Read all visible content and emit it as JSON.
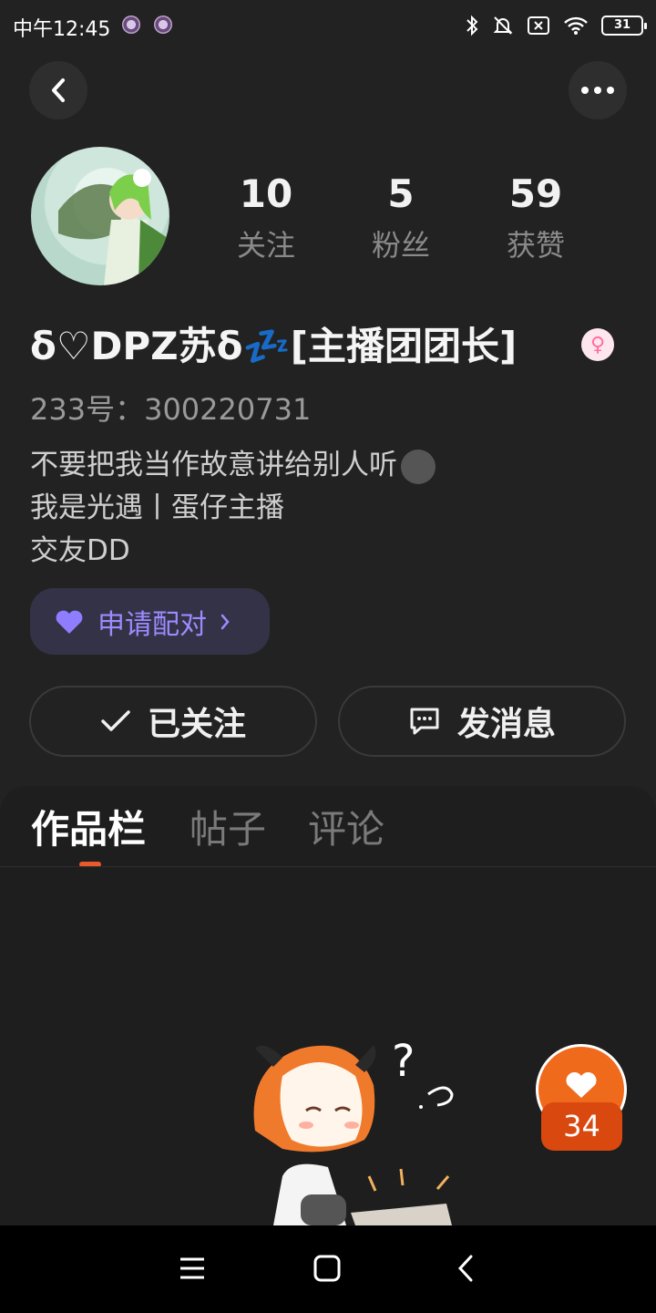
{
  "status_bar": {
    "time": "中午12:45",
    "battery": "31"
  },
  "profile": {
    "stats": [
      {
        "value": "10",
        "label": "关注"
      },
      {
        "value": "5",
        "label": "粉丝"
      },
      {
        "value": "59",
        "label": "获赞"
      }
    ],
    "nickname": "δ♡DPZ苏δ💤[主播团团长]",
    "gender_symbol": "♀",
    "uid": "233号：300220731",
    "bio_lines": [
      "不要把我当作故意讲给别人听",
      "我是光遇丨蛋仔主播",
      "交友DD"
    ],
    "pair_button": "申请配对",
    "follow_button": "已关注",
    "message_button": "发消息"
  },
  "tabs": [
    {
      "label": "作品栏",
      "active": true
    },
    {
      "label": "帖子",
      "active": false
    },
    {
      "label": "评论",
      "active": false
    }
  ],
  "like": {
    "count": "34"
  },
  "colors": {
    "background": "#222222",
    "accent_orange": "#f06a1c",
    "tab_indicator": "#e95a2a",
    "pair_purple": "#9a8cff"
  }
}
